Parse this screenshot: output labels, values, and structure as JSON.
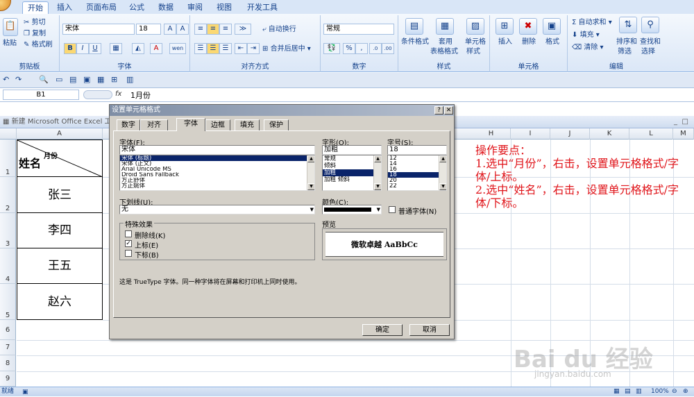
{
  "ribbon": {
    "tabs": [
      "开始",
      "插入",
      "页面布局",
      "公式",
      "数据",
      "审阅",
      "视图",
      "开发工具"
    ],
    "active_tab": "开始",
    "groups": {
      "clipboard": {
        "label": "剪贴板",
        "paste": "粘贴",
        "cut": "剪切",
        "copy": "复制",
        "painter": "格式刷"
      },
      "font": {
        "label": "字体",
        "font_name": "宋体",
        "font_size": "18",
        "bold": "B",
        "italic": "I",
        "underline": "U",
        "fontcolor": "A",
        "phonetic": "wen"
      },
      "align": {
        "label": "对齐方式",
        "wrap": "自动换行",
        "merge": "合并后居中"
      },
      "number": {
        "label": "数字",
        "format": "常规",
        "percent": "%",
        "comma": ","
      },
      "styles": {
        "label": "样式",
        "cond": "条件格式",
        "table_fmt_1": "套用",
        "table_fmt_2": "表格格式",
        "cell_style_1": "单元格",
        "cell_style_2": "样式"
      },
      "cells": {
        "label": "单元格",
        "insert": "插入",
        "delete": "删除",
        "format": "格式"
      },
      "edit": {
        "label": "编辑",
        "autosum": "自动求和",
        "fill": "填充",
        "clear": "清除",
        "sort_1": "排序和",
        "sort_2": "筛选",
        "find_1": "查找和",
        "find_2": "选择"
      }
    }
  },
  "formula_bar": {
    "name_box": "B1",
    "fx": "fx",
    "value": "1月份"
  },
  "workbook": {
    "title": "新建 Microsoft Office Excel 工作表",
    "columns": [
      "A",
      "H",
      "I",
      "J",
      "K",
      "L",
      "M"
    ],
    "rows": [
      "1",
      "2",
      "3",
      "4",
      "5",
      "6",
      "7",
      "8",
      "9"
    ],
    "cells": {
      "a1_main": "姓名",
      "a1_super": "月份",
      "a2": "张三",
      "a3": "李四",
      "a4": "王五",
      "a5": "赵六"
    }
  },
  "dialog": {
    "title": "设置单元格格式",
    "tabs": [
      "数字",
      "对齐",
      "字体",
      "边框",
      "填充",
      "保护"
    ],
    "active_tab": "字体",
    "font_label": "字体(F):",
    "font_value": "宋体",
    "font_list": [
      "宋体 (标题)",
      "宋体 (正文)",
      "Arial Unicode MS",
      "Droid Sans Fallback",
      "方正舒体",
      "方正姚体"
    ],
    "style_label": "字形(O):",
    "style_value": "加粗",
    "style_list": [
      "常规",
      "倾斜",
      "加粗",
      "加粗 倾斜"
    ],
    "size_label": "字号(S):",
    "size_value": "18",
    "size_list": [
      "12",
      "14",
      "16",
      "18",
      "20",
      "22"
    ],
    "underline_label": "下划线(U):",
    "underline_value": "无",
    "color_label": "颜色(C):",
    "normal_font": "普通字体(N)",
    "effects_label": "特殊效果",
    "strike": "删除线(K)",
    "superscript": "上标(E)",
    "subscript": "下标(B)",
    "preview_label": "预览",
    "preview_text": "微软卓越  AaBbCc",
    "info": "这是 TrueType 字体。同一种字体将在屏幕和打印机上同时使用。",
    "ok": "确定",
    "cancel": "取消"
  },
  "note": {
    "title": "操作要点：",
    "step1": "1.选中“月份”，右击，设置单元格格式/字体/上标。",
    "step2": "2.选中“姓名”，右击，设置单元格格式/字体/下标。"
  },
  "status": {
    "ready": "就绪",
    "zoom": "100%"
  },
  "watermark": {
    "logo": "Bai du 经验",
    "url": "jingyan.baidu.com"
  }
}
